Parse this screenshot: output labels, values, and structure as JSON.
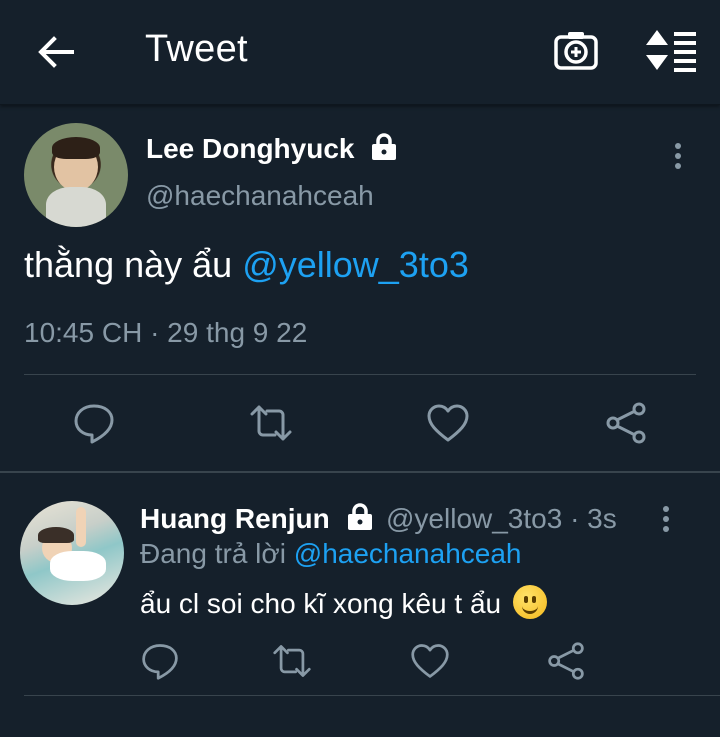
{
  "header": {
    "title": "Tweet",
    "icons": [
      "back-arrow-icon",
      "camera-icon",
      "sort-icon"
    ]
  },
  "tweet": {
    "display_name": "Lee Donghyuck",
    "handle": "@haechanahceah",
    "text_prefix": "thằng này ẩu ",
    "mention": "@yellow_3to3",
    "timestamp": "10:45 CH · 29 thg 9 22",
    "actions": [
      "reply-icon",
      "retweet-icon",
      "like-icon",
      "share-icon"
    ]
  },
  "reply": {
    "display_name": "Huang Renjun",
    "handle_time": "@yellow_3to3 · 3s",
    "replying_to_label": "Đang trả lời ",
    "replying_to_mention": "@haechanahceah",
    "text": "ẩu cl soi cho kĩ xong kêu t ẩu",
    "emoji": "slightly-smiling-face"
  },
  "colors": {
    "background": "#15202b",
    "accent": "#1da1f2",
    "secondary_text": "#8899a6",
    "divider": "#38444d"
  }
}
